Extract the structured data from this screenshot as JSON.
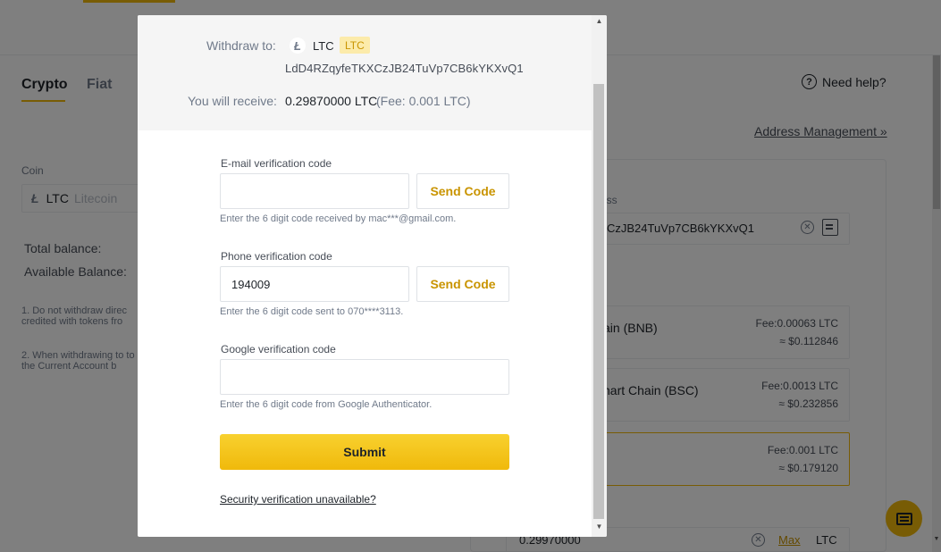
{
  "background": {
    "tabs": [
      {
        "label": "Crypto"
      },
      {
        "label": "Fiat"
      }
    ],
    "coin_label": "Coin",
    "coin_symbol": "LTC",
    "coin_name": "Litecoin",
    "coin_icon": "Ł",
    "total_balance_label": "Total balance:",
    "available_balance_label": "Available Balance:",
    "note1": "1. Do not withdraw direc credited with tokens fro",
    "note2": "2. When withdrawing to to the Current Account b",
    "need_help": "Need help?",
    "address_management": "Address Management »",
    "address_label": "ess",
    "address_value": "CzJB24TuVp7CB6kYKXvQ1",
    "networks": [
      {
        "name": "ain (BNB)",
        "fee": "Fee:0.00063 LTC",
        "usd": "≈ $0.112846",
        "selected": false
      },
      {
        "name": "nart Chain (BSC)",
        "fee": "Fee:0.0013 LTC",
        "usd": "≈ $0.232856",
        "selected": false
      },
      {
        "name": "",
        "fee": "Fee:0.001 LTC",
        "usd": "≈ $0.179120",
        "selected": true
      }
    ],
    "amount_value": "0.29970000",
    "max_label": "Max",
    "amount_unit": "LTC"
  },
  "modal": {
    "withdraw_to_label": "Withdraw to:",
    "coin_icon": "Ł",
    "coin_symbol": "LTC",
    "coin_badge": "LTC",
    "address": "LdD4RZqyfeTKXCzJB24TuVp7CB6kYKXvQ1",
    "receive_label": "You will receive:",
    "receive_amount": "0.29870000 LTC",
    "receive_fee": "(Fee: 0.001 LTC)",
    "email": {
      "label": "E-mail verification code",
      "value": "",
      "button": "Send Code",
      "hint": "Enter the 6 digit code received by mac***@gmail.com."
    },
    "phone": {
      "label": "Phone verification code",
      "value": "194009",
      "button": "Send Code",
      "hint": "Enter the 6 digit code sent to 070****3113."
    },
    "google": {
      "label": "Google verification code",
      "value": "",
      "hint": "Enter the 6 digit code from Google Authenticator."
    },
    "submit_label": "Submit",
    "security_link": "Security verification unavailable?"
  },
  "colors": {
    "accent": "#f0b90b",
    "accent_text": "#c99400",
    "overlay": "rgba(0,0,0,0.5)"
  },
  "icons": [
    "litecoin-icon",
    "help-icon",
    "clear-icon",
    "address-book-icon",
    "chat-icon"
  ]
}
